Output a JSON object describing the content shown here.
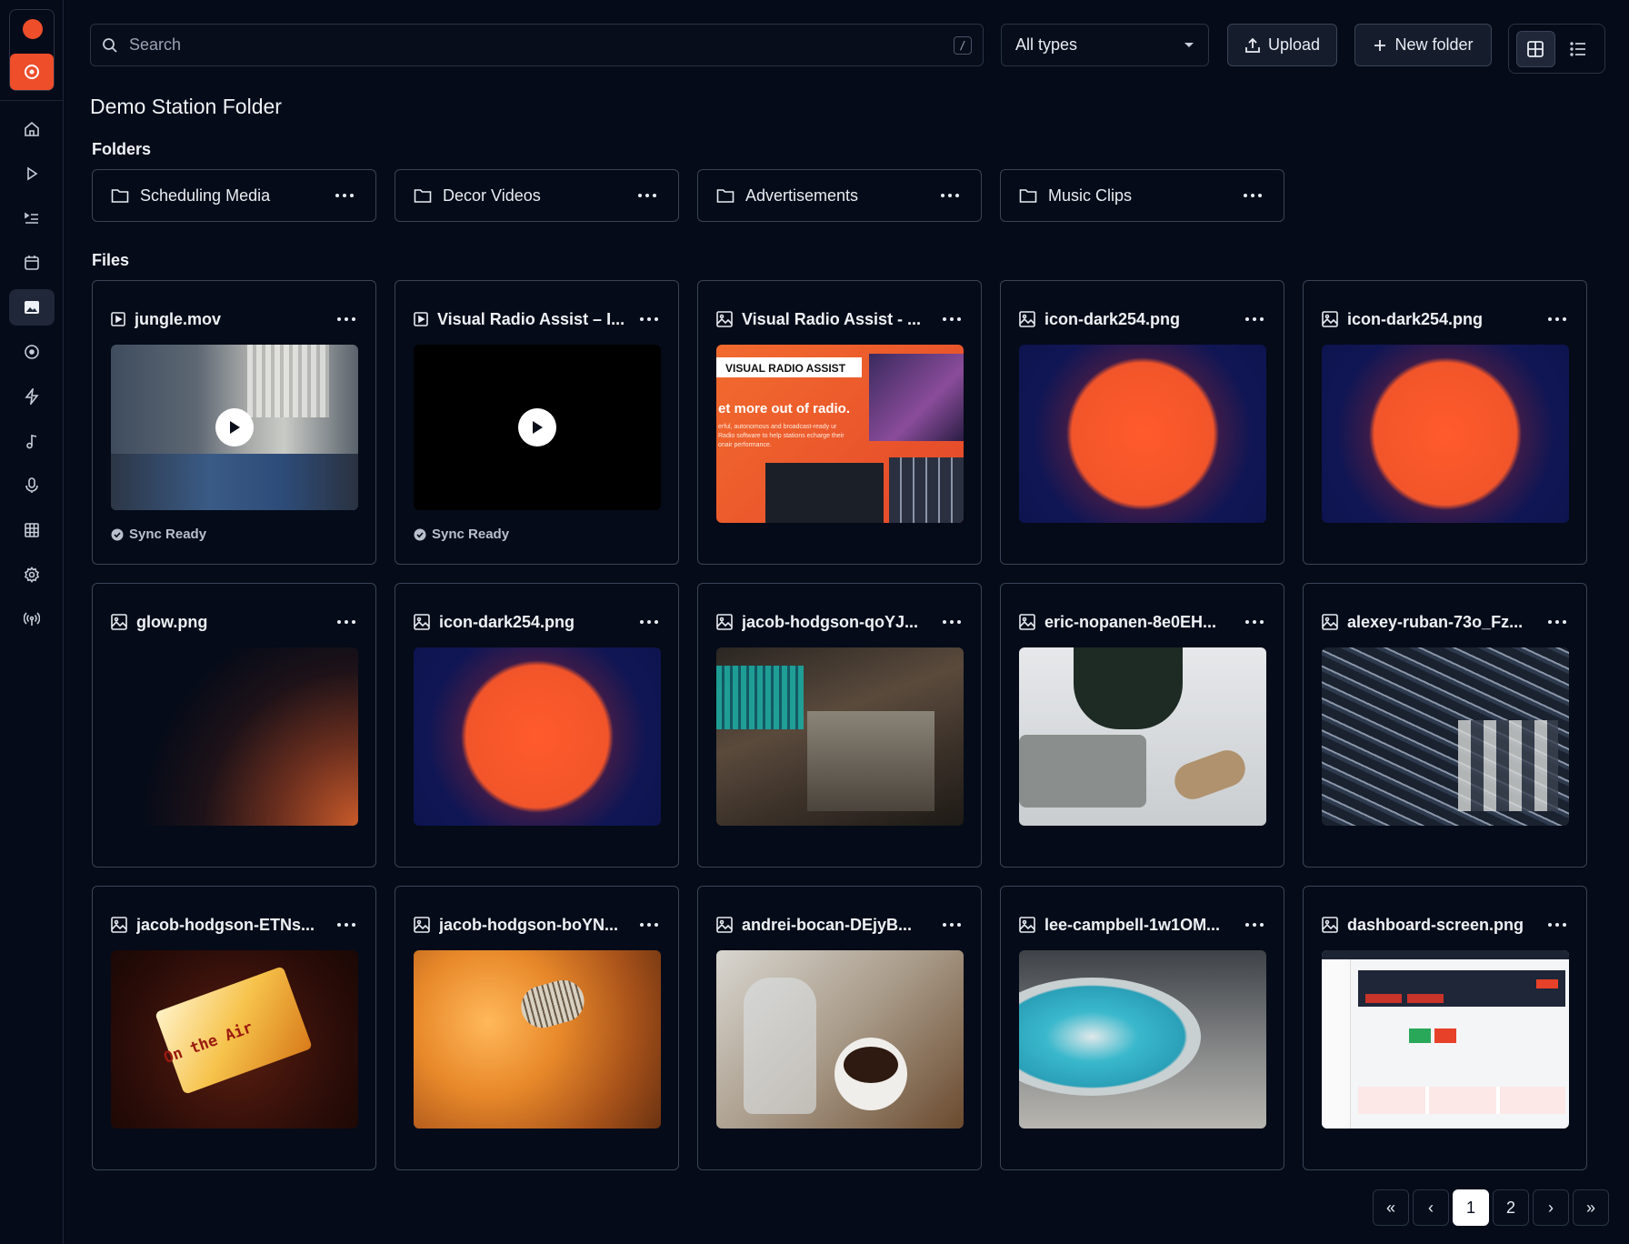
{
  "search": {
    "placeholder": "Search",
    "shortcut": "/"
  },
  "filter": {
    "selected": "All types"
  },
  "toolbar": {
    "upload_label": "Upload",
    "new_folder_label": "New folder"
  },
  "page": {
    "title": "Demo Station Folder",
    "folders_label": "Folders",
    "files_label": "Files"
  },
  "folders": [
    {
      "name": "Scheduling Media"
    },
    {
      "name": "Decor Videos"
    },
    {
      "name": "Advertisements"
    },
    {
      "name": "Music Clips"
    }
  ],
  "files": [
    {
      "name": "jungle.mov",
      "kind": "video",
      "status": "Sync Ready"
    },
    {
      "name": "Visual Radio Assist – I...",
      "kind": "video",
      "status": "Sync Ready"
    },
    {
      "name": "Visual Radio Assist - ...",
      "kind": "image",
      "thumb_text": {
        "header": "VISUAL RADIO ASSIST",
        "headline": "et more out of radio.",
        "body": "erful, autonomous and broadcast-ready ur Radio software to help stations echarge their onair performance."
      }
    },
    {
      "name": "icon-dark254.png",
      "kind": "image"
    },
    {
      "name": "icon-dark254.png",
      "kind": "image"
    },
    {
      "name": "glow.png",
      "kind": "image"
    },
    {
      "name": "icon-dark254.png",
      "kind": "image"
    },
    {
      "name": "jacob-hodgson-qoYJ...",
      "kind": "image"
    },
    {
      "name": "eric-nopanen-8e0EH...",
      "kind": "image"
    },
    {
      "name": "alexey-ruban-73o_Fz...",
      "kind": "image"
    },
    {
      "name": "jacob-hodgson-ETNs...",
      "kind": "image",
      "thumb_text": {
        "sign": "On the Air"
      }
    },
    {
      "name": "jacob-hodgson-boYN...",
      "kind": "image"
    },
    {
      "name": "andrei-bocan-DEjyB...",
      "kind": "image"
    },
    {
      "name": "lee-campbell-1w1OM...",
      "kind": "image"
    },
    {
      "name": "dashboard-screen.png",
      "kind": "image"
    }
  ],
  "pagination": {
    "first": "«",
    "prev": "‹",
    "pages": [
      "1",
      "2"
    ],
    "current": "1",
    "next": "›",
    "last": "»"
  },
  "colors": {
    "accent": "#ef4e2b",
    "background": "#050b18",
    "border": "#3a4456"
  }
}
